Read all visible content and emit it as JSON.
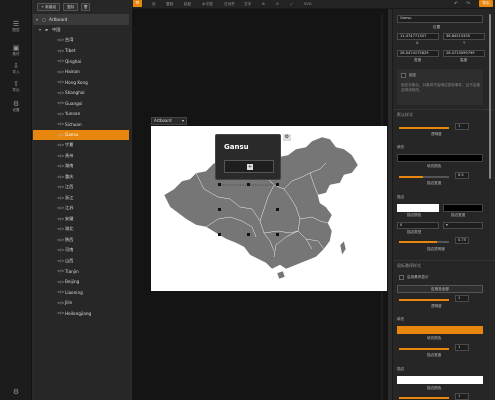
{
  "rail": [
    {
      "icon": "☰",
      "label": "图层"
    },
    {
      "icon": "▣",
      "label": "素材"
    },
    {
      "icon": "⇩",
      "label": "导入"
    },
    {
      "icon": "⇧",
      "label": "导出"
    },
    {
      "icon": "⚙",
      "label": "设置"
    }
  ],
  "rail_bottom_icon": "⚙",
  "panel": {
    "new_group": "+ 新建组",
    "copy": "复制",
    "delete": "🗑"
  },
  "tree": {
    "root": "Artboard",
    "group": "中国",
    "items": [
      "台湾",
      "Tibet",
      "Qinghai",
      "Hainan",
      "Hong Kong",
      "Shanghai",
      "Guangxi",
      "Yunnan",
      "Sichuan",
      "Gansu",
      "宁夏",
      "贵州",
      "湖南",
      "重庆",
      "江西",
      "浙江",
      "江苏",
      "安徽",
      "湖北",
      "陕西",
      "河南",
      "山西",
      "Tianjin",
      "Beijing",
      "Liaoning",
      "Jilin",
      "Heilongjiang"
    ],
    "selected": "Gansu"
  },
  "topbar": {
    "items": [
      "设",
      "复制",
      "粘贴",
      "水平居",
      "左对齐",
      "文字",
      "SVG"
    ],
    "export": "导出",
    "undo": "↶",
    "redo": "↷"
  },
  "canvas": {
    "artboard_select": "Artboard",
    "tooltip_title": "Gansu",
    "tooltip_plus": "+",
    "gear": "⚙"
  },
  "right": {
    "name_value": "Gansu",
    "coords_label": "位置",
    "x_value": "11.474771307",
    "y_value": "36.84515335",
    "x_label": "X",
    "y_label": "Y",
    "w_value": "26.0474175629",
    "h_value": "26.4715099799",
    "w_label": "宽度",
    "h_label": "高度",
    "lock_label": "锁定",
    "lock_desc": "锁定对象后，对象将不会响应鼠标事件，且不会被选择或修改。",
    "section1": "默认样式",
    "opacity_label": "透明度",
    "opacity_value": "1",
    "fill_label": "填充",
    "fill_type_label": "填充颜色",
    "stroke_label": "描边",
    "stroke_value": "0.5",
    "stroke_width_label": "描边宽度",
    "border_label": "描边",
    "border_color_label": "描边颜色",
    "border_width_label": "描边宽度",
    "dash_value": "0",
    "dash_label": "描边类型",
    "dash2_value": "0.75",
    "dash2_label": "描边透明度",
    "section2": "鼠标悬停样式",
    "hover_check_label": "启用悬停显示",
    "hover_btn": "应用至全部",
    "hover_opacity_label": "透明度",
    "hover_opacity_value": "1",
    "hover_fill_label": "填充",
    "hover_fill_type": "填充颜色",
    "hover_stroke_label": "描边宽度",
    "hover_stroke_value": "1",
    "border2_label": "描边",
    "border2_color_label": "描边颜色",
    "border2_value": "1",
    "accent": "#e8870e"
  }
}
